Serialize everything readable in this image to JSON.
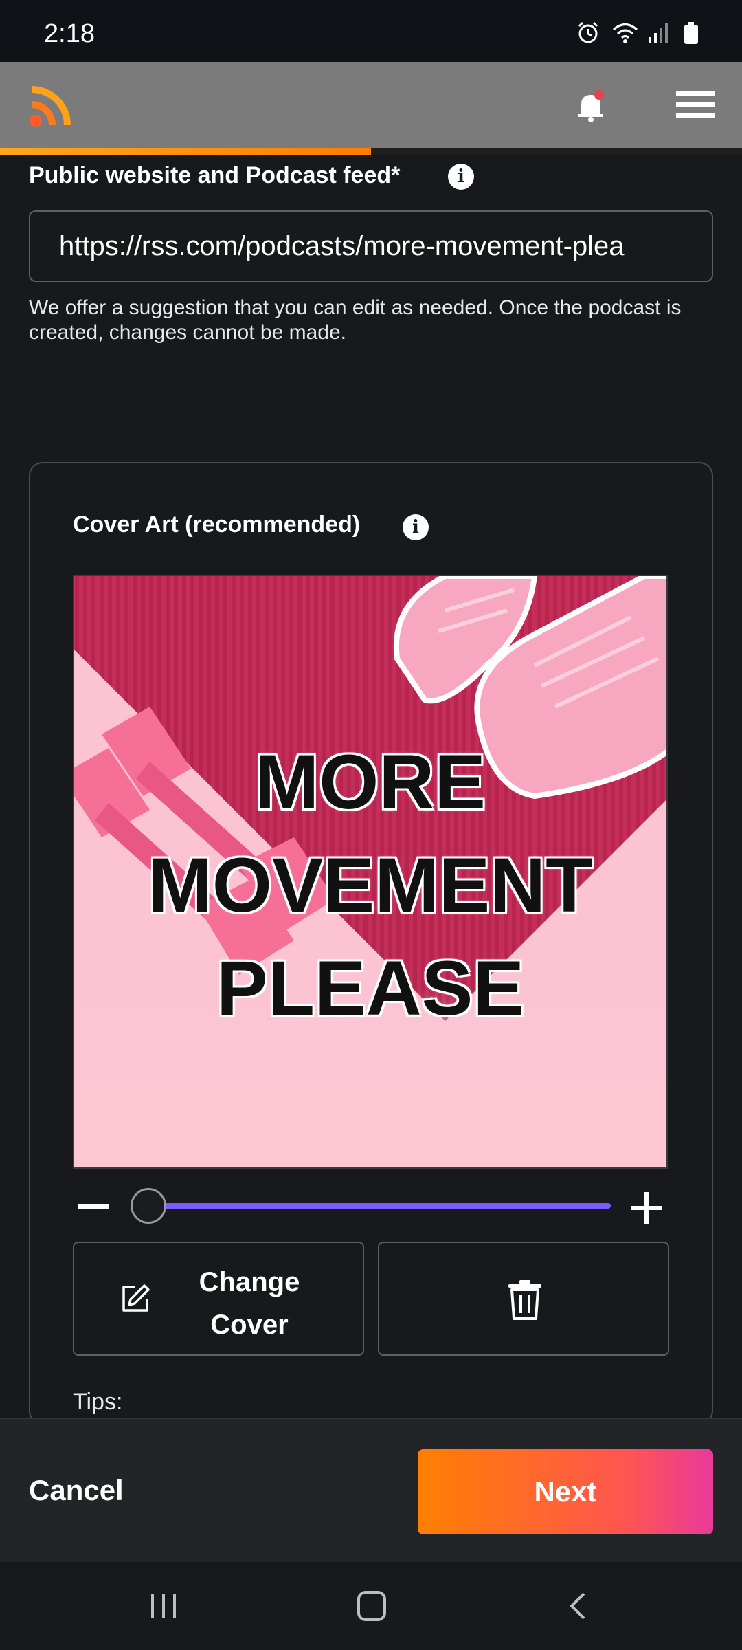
{
  "status_bar": {
    "time": "2:18",
    "icons": [
      "alarm-icon",
      "wifi-icon",
      "signal-icon",
      "battery-icon"
    ]
  },
  "header": {
    "logo": "rss-logo",
    "notification_icon": "bell-icon",
    "menu_icon": "hamburger-menu-icon",
    "progress": 0.5
  },
  "feed_field": {
    "label": "Public website and Podcast feed*",
    "info_symbol": "i",
    "value": "https://rss.com/podcasts/more-movement-plea",
    "helper": "We offer a suggestion that you can edit as needed. Once the podcast is created, changes cannot be made."
  },
  "cover_section": {
    "title": "Cover Art (recommended)",
    "info_symbol": "i",
    "cover_text": [
      "MORE",
      "MOVEMENT",
      "PLEASE"
    ],
    "zoom_level": 0.0,
    "change_label_line1": "Change",
    "change_label_line2": "Cover",
    "tips": "Tips:"
  },
  "footer": {
    "cancel": "Cancel",
    "next": "Next"
  },
  "colors": {
    "accent_orange": "#ff8000",
    "slider": "#7a5cff",
    "background": "#17191c"
  }
}
